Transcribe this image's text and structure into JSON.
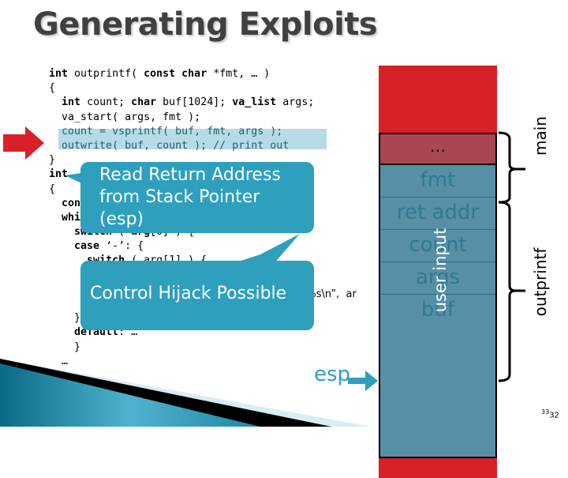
{
  "slide": {
    "title": "Generating Exploits",
    "page_number": "32",
    "page_number_overlap": "33"
  },
  "code": {
    "lines": [
      "int outprintf( const char *fmt, … )",
      "{",
      "  int count; char buf[1024]; va_list args;",
      "  va_start( args, fmt );",
      "  count = vsprintf( buf, fmt, args );",
      "  outwrite( buf, count ); // print out",
      "}",
      "int",
      "{",
      "  con",
      "  whi",
      "    switch ( arg[0] ) {",
      "    case ‘-’: {",
      "      switch ( arg[1] ) {",
      "",
      "",
      "",
      "    }",
      "    default: …",
      "    }",
      "  …"
    ],
    "partial_visible": "n %s\\n”,  ar",
    "highlighted_lines": [
      4,
      5
    ]
  },
  "callouts": {
    "read_return": "Read Return Address\nfrom Stack Pointer\n(esp)",
    "read_return_lines": [
      "Read Return Address",
      "from Stack Pointer",
      "(esp)"
    ],
    "hijack": "Control Hijack Possible"
  },
  "stack": {
    "main_cell": "…",
    "frame_slots": [
      "fmt",
      "ret addr",
      "count",
      "args",
      "buf"
    ],
    "overlay_label": "user input",
    "brace_labels": {
      "main": "main",
      "outprintf": "outprintf"
    },
    "pointer_label": "esp"
  },
  "colors": {
    "accent": "#2e9fbd",
    "stack_red": "#d82029",
    "main_frame": "#a84651",
    "outprintf_frame": "#568fa6",
    "highlight": "#b7dbe6",
    "title": "#404040"
  }
}
